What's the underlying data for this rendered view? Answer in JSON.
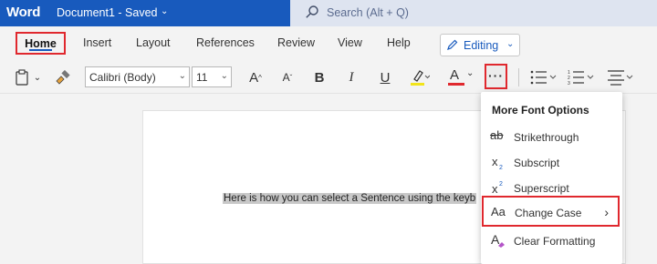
{
  "titlebar": {
    "app_name": "Word",
    "doc_title": "Document1  -  Saved",
    "search_placeholder": "Search (Alt + Q)"
  },
  "tabs": {
    "home": "Home",
    "insert": "Insert",
    "layout": "Layout",
    "references": "References",
    "review": "Review",
    "view": "View",
    "help": "Help",
    "editing": "Editing"
  },
  "toolbar": {
    "font_name": "Calibri (Body)",
    "font_size": "11",
    "grow_font": "A",
    "shrink_font": "A",
    "bold": "B",
    "italic": "I",
    "underline": "U",
    "font_color": "A",
    "more": "···"
  },
  "document": {
    "selected_text": "Here is how you can select a Sentence using the keyb"
  },
  "menu": {
    "header": "More Font Options",
    "items": [
      {
        "icon": "ab",
        "label": "Strikethrough"
      },
      {
        "icon": "X2",
        "label": "Subscript"
      },
      {
        "icon": "X2",
        "label": "Superscript"
      },
      {
        "icon": "Aa",
        "label": "Change Case"
      },
      {
        "icon": "A",
        "label": "Clear Formatting"
      }
    ]
  },
  "colors": {
    "title_bar": "#185abd",
    "highlight_box": "#e0282e",
    "highlighter_yellow": "#f2e41a",
    "font_color_red": "#e0282e"
  }
}
